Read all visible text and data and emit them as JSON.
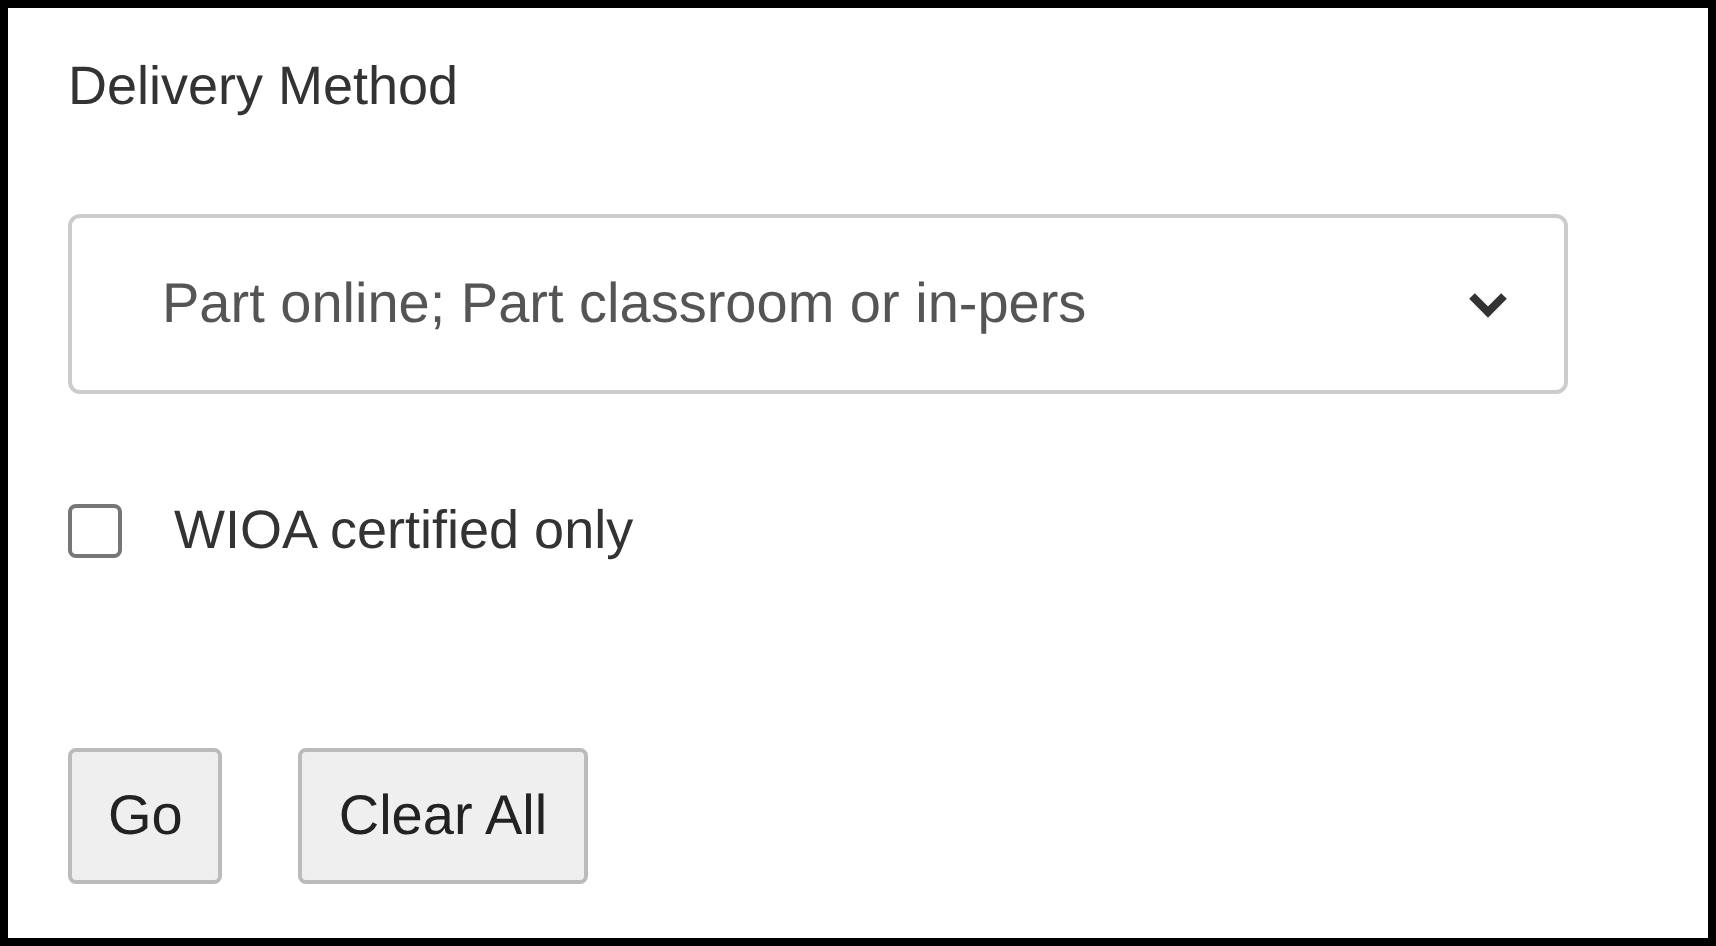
{
  "delivery_method": {
    "label": "Delivery Method",
    "value": "Part online; Part classroom or in-pers"
  },
  "wioa_filter": {
    "label": "WIOA certified only",
    "checked": false
  },
  "buttons": [
    {
      "label": "Go"
    },
    {
      "label": "Clear All"
    }
  ]
}
